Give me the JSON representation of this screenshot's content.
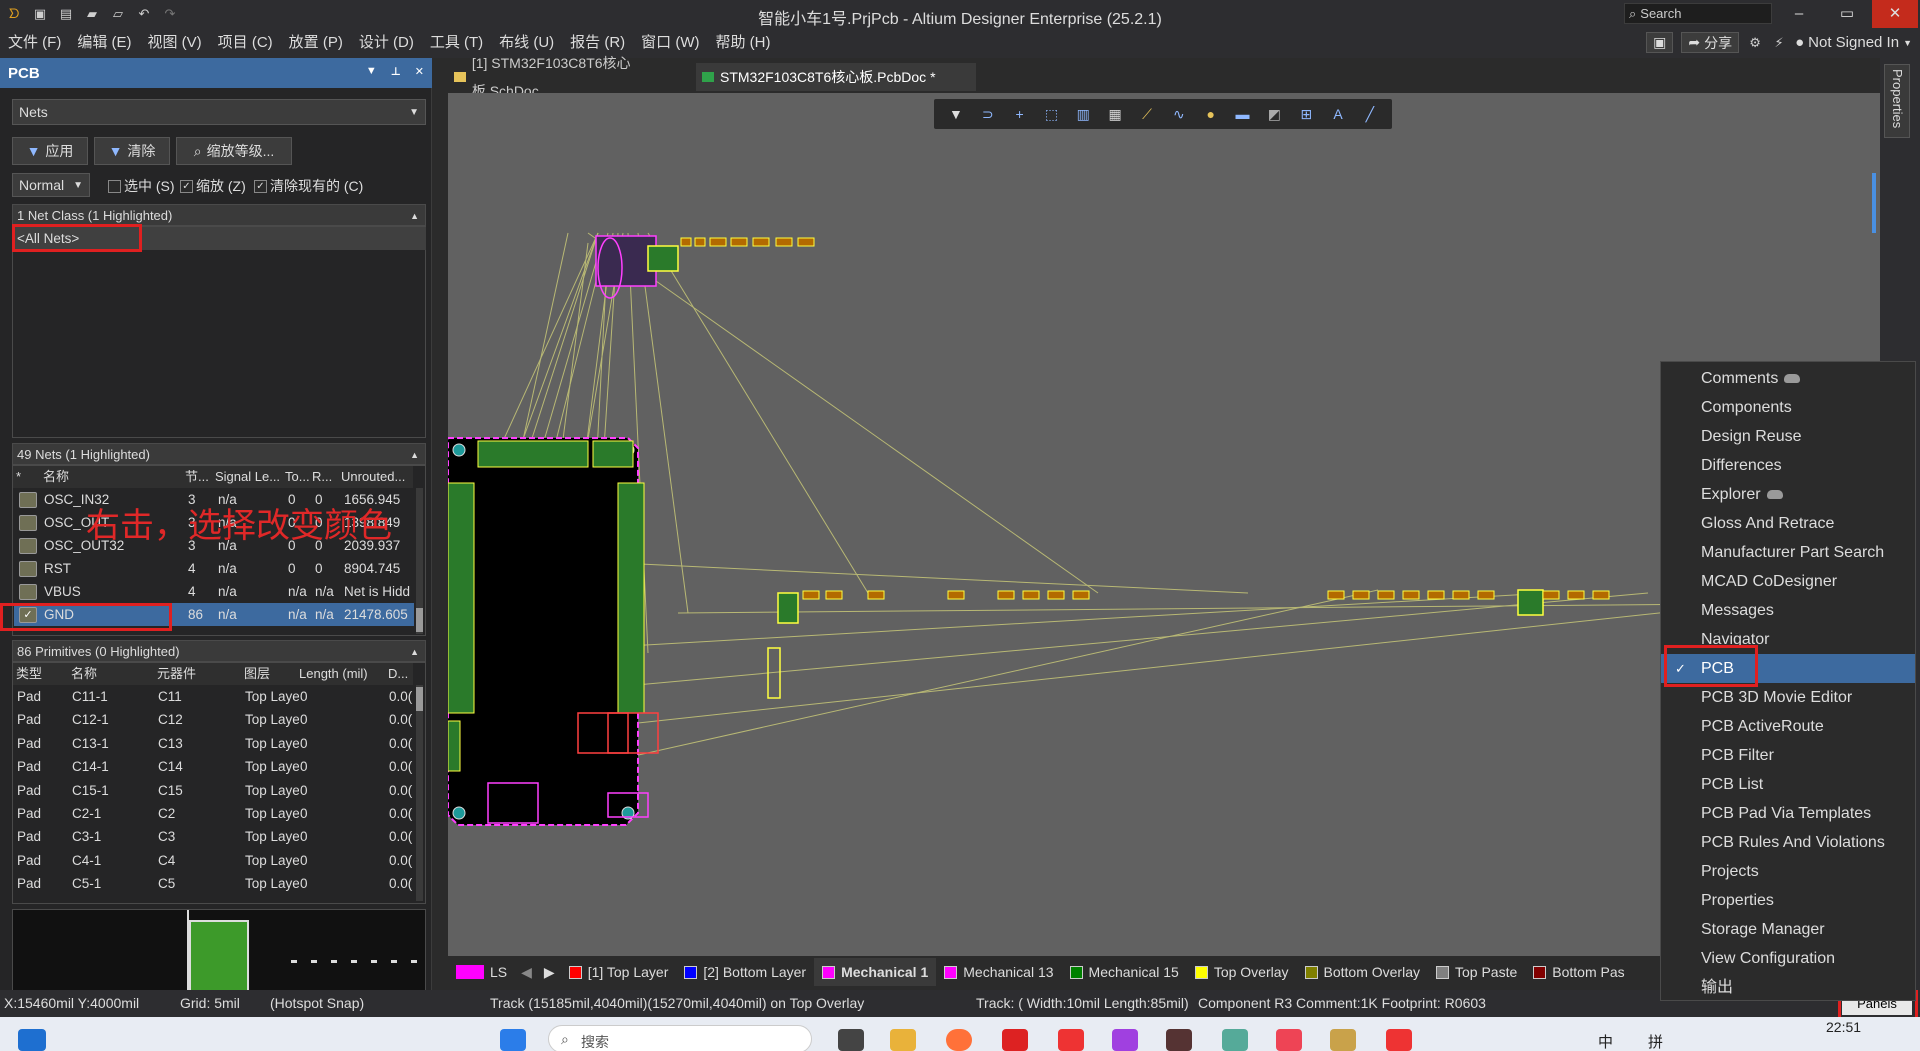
{
  "window": {
    "title": "智能小车1号.PrjPcb - Altium Designer Enterprise (25.2.1)",
    "search_placeholder": "Search",
    "minimize": "–",
    "restore": "▭",
    "close": "✕"
  },
  "menu": {
    "items": [
      "文件 (F)",
      "编辑 (E)",
      "视图 (V)",
      "项目 (C)",
      "放置 (P)",
      "设计 (D)",
      "工具 (T)",
      "布线 (U)",
      "报告 (R)",
      "窗口 (W)",
      "帮助 (H)"
    ],
    "share": "分享",
    "account": "Not Signed In"
  },
  "panel": {
    "title": "PCB",
    "mode": "Nets",
    "apply": "应用",
    "clear": "清除",
    "zoom_level": "缩放等级...",
    "mask_mode": "Normal",
    "opt_select": "选中 (S)",
    "opt_zoom": "缩放 (Z)",
    "opt_clear_existing": "清除现有的 (C)",
    "netclass_header": "1 Net Class (1 Highlighted)",
    "netclass_items": [
      "<All Nets>"
    ],
    "nets_header": "49 Nets (1 Highlighted)",
    "nets_columns": [
      "*",
      "名称",
      "节...",
      "Signal Le...",
      "To...",
      "R...",
      "Unrouted..."
    ],
    "nets": [
      {
        "name": "OSC_IN32",
        "nodes": "3",
        "signal": "n/a",
        "to": "0",
        "r": "0",
        "unrouted": "1656.945",
        "checked": ""
      },
      {
        "name": "OSC_OUT",
        "nodes": "3",
        "signal": "n/a",
        "to": "0",
        "r": "0",
        "unrouted": "1398.849",
        "checked": ""
      },
      {
        "name": "OSC_OUT32",
        "nodes": "3",
        "signal": "n/a",
        "to": "0",
        "r": "0",
        "unrouted": "2039.937",
        "checked": ""
      },
      {
        "name": "RST",
        "nodes": "4",
        "signal": "n/a",
        "to": "0",
        "r": "0",
        "unrouted": "8904.745",
        "checked": ""
      },
      {
        "name": "VBUS",
        "nodes": "4",
        "signal": "n/a",
        "to": "n/a",
        "r": "n/a",
        "unrouted": "Net is Hidd",
        "checked": ""
      },
      {
        "name": "GND",
        "nodes": "86",
        "signal": "n/a",
        "to": "n/a",
        "r": "n/a",
        "unrouted": "21478.605",
        "checked": "✓"
      }
    ],
    "annotation": "右击，选择改变颜色",
    "prims_header": "86 Primitives (0 Highlighted)",
    "prims_columns": [
      "类型",
      "名称",
      "元器件",
      "图层",
      "Length (mil)",
      "D..."
    ],
    "prims": [
      {
        "type": "Pad",
        "name": "C11-1",
        "comp": "C11",
        "layer": "Top Laye",
        "len": "0",
        "d": "0.0("
      },
      {
        "type": "Pad",
        "name": "C12-1",
        "comp": "C12",
        "layer": "Top Laye",
        "len": "0",
        "d": "0.0("
      },
      {
        "type": "Pad",
        "name": "C13-1",
        "comp": "C13",
        "layer": "Top Laye",
        "len": "0",
        "d": "0.0("
      },
      {
        "type": "Pad",
        "name": "C14-1",
        "comp": "C14",
        "layer": "Top Laye",
        "len": "0",
        "d": "0.0("
      },
      {
        "type": "Pad",
        "name": "C15-1",
        "comp": "C15",
        "layer": "Top Laye",
        "len": "0",
        "d": "0.0("
      },
      {
        "type": "Pad",
        "name": "C2-1",
        "comp": "C2",
        "layer": "Top Laye",
        "len": "0",
        "d": "0.0("
      },
      {
        "type": "Pad",
        "name": "C3-1",
        "comp": "C3",
        "layer": "Top Laye",
        "len": "0",
        "d": "0.0("
      },
      {
        "type": "Pad",
        "name": "C4-1",
        "comp": "C4",
        "layer": "Top Laye",
        "len": "0",
        "d": "0.0("
      },
      {
        "type": "Pad",
        "name": "C5-1",
        "comp": "C5",
        "layer": "Top Laye",
        "len": "0",
        "d": "0.0("
      }
    ]
  },
  "tabs": [
    {
      "label": "[1] STM32F103C8T6核心板.SchDoc"
    },
    {
      "label": "STM32F103C8T6核心板.PcbDoc *"
    }
  ],
  "layers": [
    {
      "label": "LS",
      "color": "#ff00ff"
    },
    {
      "label": "[1] Top Layer",
      "color": "#ff0000"
    },
    {
      "label": "[2] Bottom Layer",
      "color": "#0000ff"
    },
    {
      "label": "Mechanical 1",
      "color": "#ff00ff"
    },
    {
      "label": "Mechanical 13",
      "color": "#ff00ff"
    },
    {
      "label": "Mechanical 15",
      "color": "#008000"
    },
    {
      "label": "Top Overlay",
      "color": "#ffff00"
    },
    {
      "label": "Bottom Overlay",
      "color": "#808000"
    },
    {
      "label": "Top Paste",
      "color": "#808080"
    },
    {
      "label": "Bottom Pas",
      "color": "#800000"
    }
  ],
  "status": {
    "coords": "X:15460mil Y:4000mil",
    "grid": "Grid: 5mil",
    "snap": "(Hotspot Snap)",
    "track1": "Track (15185mil,4040mil)(15270mil,4040mil) on Top Overlay",
    "track2": "Track: ( Width:10mil Length:85mil)",
    "component": "Component R3 Comment:1K Footprint: R0603",
    "panels": "Panels"
  },
  "popup_menu": {
    "items": [
      "Comments",
      "Components",
      "Design Reuse",
      "Differences",
      "Explorer",
      "Gloss And Retrace",
      "Manufacturer Part Search",
      "MCAD CoDesigner",
      "Messages",
      "Navigator",
      "PCB",
      "PCB 3D Movie Editor",
      "PCB ActiveRoute",
      "PCB Filter",
      "PCB List",
      "PCB Pad Via Templates",
      "PCB Rules And Violations",
      "Projects",
      "Properties",
      "Storage Manager",
      "View Configuration",
      "输出"
    ],
    "selected": "PCB",
    "check": "✓"
  },
  "right_strip": {
    "properties_label": "Properties"
  },
  "taskbar": {
    "search": "搜索",
    "time": "22:51",
    "ime1": "中",
    "ime2": "拼"
  }
}
